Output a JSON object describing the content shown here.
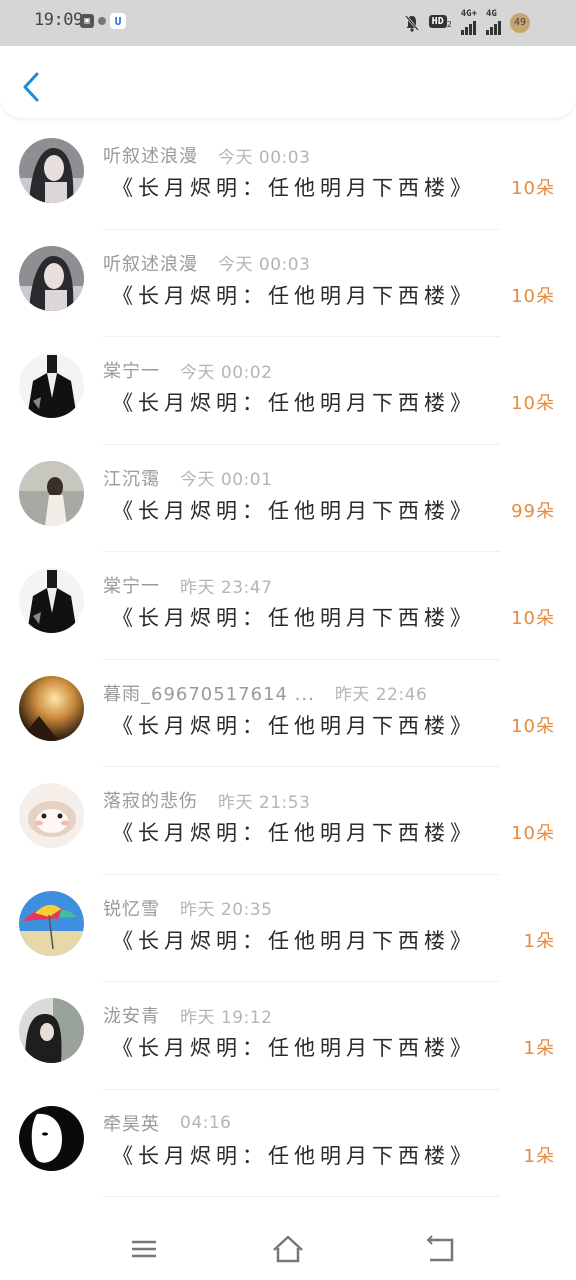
{
  "status_bar": {
    "time": "19:09",
    "hd_label": "HD",
    "hd_sub": "2",
    "net1": "4G+",
    "net2": "4G",
    "battery": "49"
  },
  "header": {
    "back_icon": "chevron-left-icon"
  },
  "gifts": [
    {
      "name": "听叙述浪漫",
      "time": "今天 00:03",
      "gift": "《长月烬明：任他明月下西楼》",
      "count": "10朵",
      "avatar": "avatar-girl-1"
    },
    {
      "name": "听叙述浪漫",
      "time": "今天 00:03",
      "gift": "《长月烬明：任他明月下西楼》",
      "count": "10朵",
      "avatar": "avatar-girl-1"
    },
    {
      "name": "棠宁一",
      "time": "今天 00:02",
      "gift": "《长月烬明：任他明月下西楼》",
      "count": "10朵",
      "avatar": "avatar-man-black"
    },
    {
      "name": "江沉霭",
      "time": "今天 00:01",
      "gift": "《长月烬明：任他明月下西楼》",
      "count": "99朵",
      "avatar": "avatar-girl-grey"
    },
    {
      "name": "棠宁一",
      "time": "昨天 23:47",
      "gift": "《长月烬明：任他明月下西楼》",
      "count": "10朵",
      "avatar": "avatar-man-black"
    },
    {
      "name": "暮雨_69670517614 ...",
      "time": "昨天 22:46",
      "gift": "《长月烬明：任他明月下西楼》",
      "count": "10朵",
      "avatar": "avatar-warm-light"
    },
    {
      "name": "落寂的悲伤",
      "time": "昨天 21:53",
      "gift": "《长月烬明：任他明月下西楼》",
      "count": "10朵",
      "avatar": "avatar-hamster"
    },
    {
      "name": "锐忆雪",
      "time": "昨天 20:35",
      "gift": "《长月烬明：任他明月下西楼》",
      "count": "1朵",
      "avatar": "avatar-beach-umbrella"
    },
    {
      "name": "泷安青",
      "time": "昨天 19:12",
      "gift": "《长月烬明：任他明月下西楼》",
      "count": "1朵",
      "avatar": "avatar-girl-dark"
    },
    {
      "name": "牵昊英",
      "time": "04:16",
      "gift": "《长月烬明：任他明月下西楼》",
      "count": "1朵",
      "avatar": "avatar-mask-bw"
    }
  ],
  "nav": {
    "menu_icon": "menu-icon",
    "home_icon": "home-icon",
    "back_icon": "back-icon"
  },
  "colors": {
    "accent": "#1a8fd8",
    "count": "#e88a3c",
    "name": "#9a9a9a"
  }
}
